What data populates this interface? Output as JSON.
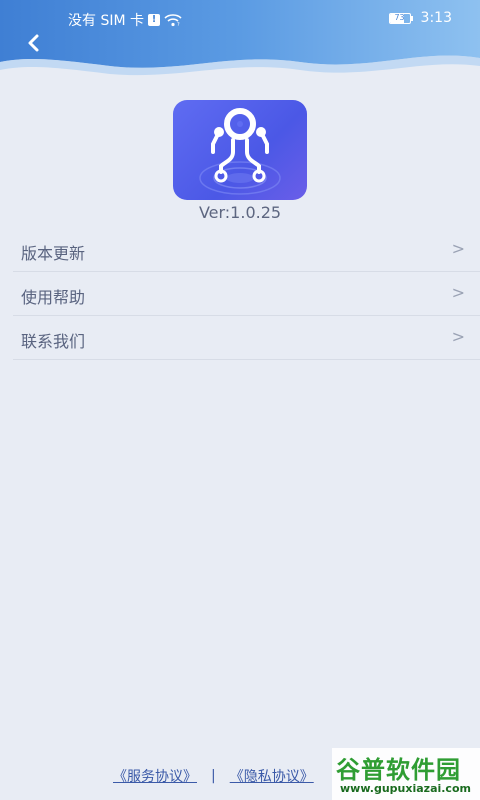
{
  "status_bar": {
    "carrier": "没有 SIM 卡",
    "sim_alert": "!",
    "battery_level": "73",
    "battery_fraction": 0.73,
    "time": "3:13"
  },
  "header": {
    "accent_color": "#4a87d6"
  },
  "app": {
    "logo_icon": "circuit-y-logo-icon",
    "version": "Ver:1.0.25"
  },
  "menu": {
    "items": [
      {
        "label": "版本更新",
        "arrow": ">"
      },
      {
        "label": "使用帮助",
        "arrow": ">"
      },
      {
        "label": "联系我们",
        "arrow": ">"
      }
    ]
  },
  "footer": {
    "service_agreement": "《服务协议》",
    "separator": "|",
    "privacy_agreement": "《隐私协议》"
  },
  "watermark": {
    "main": "谷普软件园",
    "url": "www.gupuxiazai.com"
  }
}
